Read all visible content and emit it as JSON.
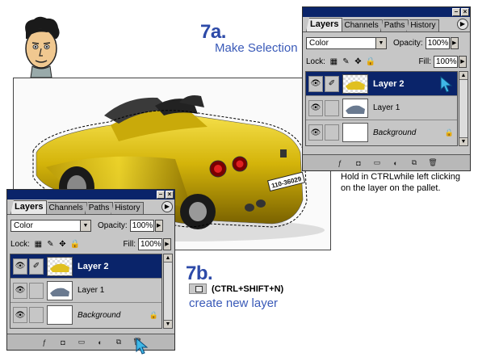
{
  "step_a": {
    "number": "7a.",
    "title": "Make Selection"
  },
  "step_b": {
    "number": "7b.",
    "shortcut": "(CTRL+SHIFT+N)",
    "title": "create new layer"
  },
  "note": {
    "line1": "Hold in CTRLwhile left clicking",
    "line2": "on the layer on the pallet."
  },
  "car": {
    "plate": "110-36029",
    "color": "#d4b40a"
  },
  "palette_top": {
    "tabs": [
      "Layers",
      "Channels",
      "Paths",
      "History"
    ],
    "blend_mode": "Color",
    "opacity_label": "Opacity:",
    "opacity_value": "100%",
    "lock_label": "Lock:",
    "fill_label": "Fill:",
    "fill_value": "100%",
    "layers": [
      {
        "name": "Layer 2",
        "selected": true
      },
      {
        "name": "Layer 1",
        "selected": false
      },
      {
        "name": "Background",
        "selected": false
      }
    ]
  },
  "palette_bottom": {
    "tabs": [
      "Layers",
      "Channels",
      "Paths",
      "History"
    ],
    "blend_mode": "Color",
    "opacity_label": "Opacity:",
    "opacity_value": "100%",
    "lock_label": "Lock:",
    "fill_label": "Fill:",
    "fill_value": "100%",
    "layers": [
      {
        "name": "Layer 2",
        "selected": true
      },
      {
        "name": "Layer 1",
        "selected": false
      },
      {
        "name": "Background",
        "selected": false
      }
    ]
  },
  "colors": {
    "accent_blue": "#2d4aa8",
    "selection_blue": "#0a246a",
    "cursor": "#3fb8e6"
  }
}
